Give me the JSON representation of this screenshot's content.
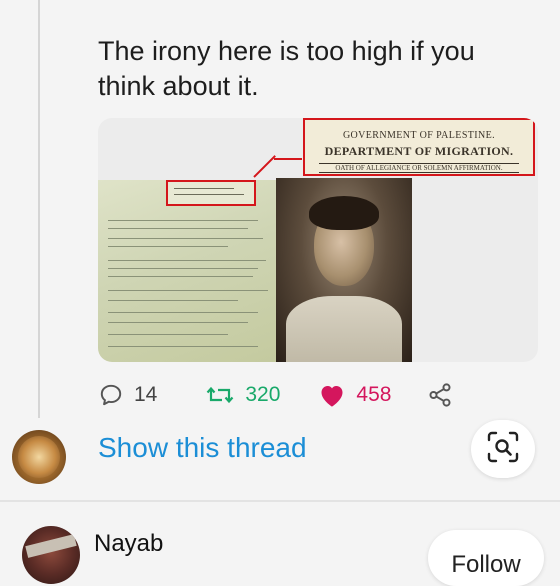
{
  "tweet": {
    "text": "The irony here is too high if you think about it.",
    "media": {
      "banner_line1": "GOVERNMENT OF PALESTINE.",
      "banner_line2": "DEPARTMENT OF MIGRATION.",
      "banner_line3": "OATH OF ALLEGIANCE OR SOLEMN AFFIRMATION."
    },
    "actions": {
      "reply_icon": "reply-icon",
      "reply_count": "14",
      "retweet_icon": "retweet-icon",
      "retweet_count": "320",
      "like_icon": "heart-icon",
      "like_count": "458",
      "share_icon": "share-icon"
    },
    "show_thread_label": "Show this thread"
  },
  "lens": {
    "icon": "lens-search-icon"
  },
  "next_user": {
    "name": "Nayab",
    "follow_label": "Follow"
  },
  "colors": {
    "link_blue": "#1b8ed6",
    "retweet_green": "#19a96a",
    "like_pink": "#d4165d",
    "highlight_red": "#d4161b",
    "background": "#f4f4f4"
  }
}
